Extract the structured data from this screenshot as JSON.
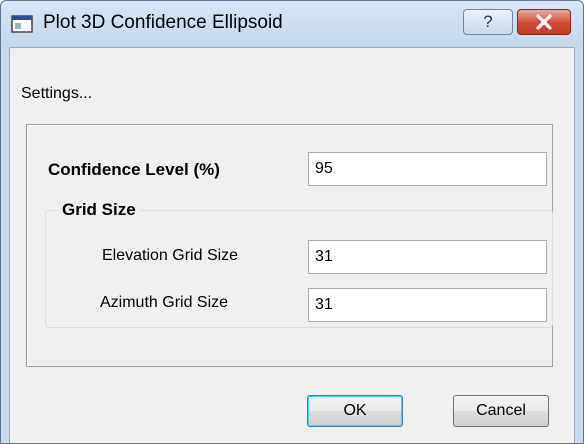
{
  "window": {
    "title": "Plot 3D Confidence Ellipsoid",
    "help_label": "?",
    "icons": {
      "app": "app-window-icon",
      "close": "close-icon"
    }
  },
  "settings_label": "Settings...",
  "confidence": {
    "label": "Confidence Level (%)",
    "value": "95"
  },
  "grid_size": {
    "title": "Grid Size",
    "elevation": {
      "label": "Elevation Grid Size",
      "value": "31"
    },
    "azimuth": {
      "label": "Azimuth Grid Size",
      "value": "31"
    }
  },
  "buttons": {
    "ok": "OK",
    "cancel": "Cancel"
  },
  "colors": {
    "title_bar": "#c4d7ec",
    "close_button": "#c94431",
    "dialog_bg": "#f0f0f0",
    "ok_focus": "#3c7fb1"
  }
}
